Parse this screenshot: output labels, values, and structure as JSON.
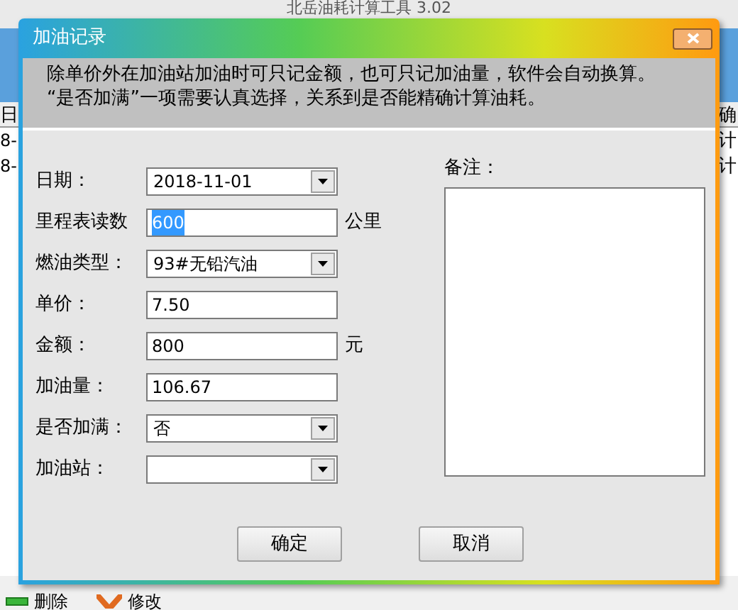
{
  "app": {
    "title": "北岳油耗计算工具 3.02",
    "left_column": {
      "header": "日",
      "cells": [
        "8-",
        "8-"
      ]
    },
    "right_column": {
      "header": "确",
      "cells": [
        "计",
        "计"
      ]
    },
    "toolbar": [
      {
        "label": "删除",
        "kind": "delete"
      },
      {
        "label": "修改",
        "kind": "edit"
      }
    ]
  },
  "dialog": {
    "title": "加油记录",
    "info": [
      "除单价外在加油站加油时可只记金额，也可只记加油量，软件会自动换算。",
      "“是否加满”一项需要认真选择，关系到是否能精确计算油耗。"
    ],
    "fields": [
      {
        "label": "日期：",
        "kind": "combo",
        "value": "2018-11-01",
        "selected": false
      },
      {
        "label": "里程表读数",
        "kind": "text",
        "value": "600",
        "unit": "公里",
        "selected": true
      },
      {
        "label": "燃油类型：",
        "kind": "combo",
        "value": "93#无铅汽油",
        "selected": false
      },
      {
        "label": "单价：",
        "kind": "text",
        "value": "7.50",
        "selected": false
      },
      {
        "label": "金额：",
        "kind": "text",
        "value": "800",
        "unit": "元",
        "selected": false
      },
      {
        "label": "加油量：",
        "kind": "text",
        "value": "106.67",
        "selected": false
      },
      {
        "label": "是否加满：",
        "kind": "combo",
        "value": "否",
        "selected": false
      },
      {
        "label": "加油站：",
        "kind": "combo",
        "selected": false
      }
    ],
    "memo_label": "备注：",
    "buttons": [
      "确定",
      "取消"
    ]
  }
}
